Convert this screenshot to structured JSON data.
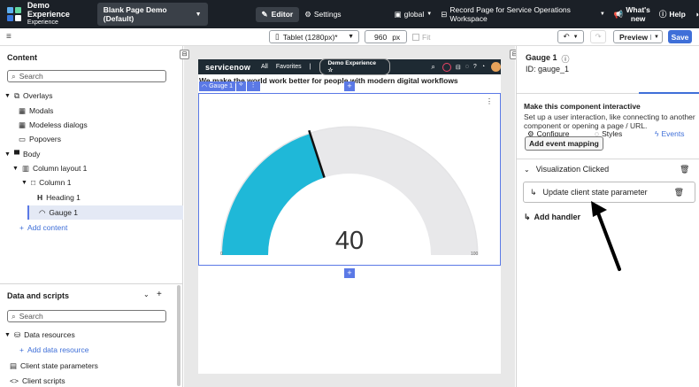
{
  "topbar": {
    "app_title": "Demo Experience",
    "app_subtitle": "Experience",
    "page_selector": "Blank Page Demo (Default)",
    "editor_label": "Editor",
    "settings_label": "Settings",
    "scope_label": "global",
    "record_page_label": "Record Page for Service Operations Workspace",
    "whats_new_line1": "What's",
    "whats_new_line2": "new",
    "help_label": "Help"
  },
  "toolbar": {
    "device_select": "Tablet (1280px)*",
    "width_value": "960",
    "width_unit": "px",
    "fit_label": "Fit",
    "preview_label": "Preview",
    "save_label": "Save"
  },
  "content_panel": {
    "title": "Content",
    "search_placeholder": "Search",
    "tree": [
      {
        "label": "Overlays",
        "icon": "layers-icon"
      },
      {
        "label": "Modals",
        "icon": "window-icon"
      },
      {
        "label": "Modeless dialogs",
        "icon": "window-icon"
      },
      {
        "label": "Popovers",
        "icon": "popover-icon"
      },
      {
        "label": "Body",
        "icon": "body-icon"
      },
      {
        "label": "Column layout 1",
        "icon": "columns-icon"
      },
      {
        "label": "Column 1",
        "icon": "column-icon"
      },
      {
        "label": "Heading 1",
        "icon": "heading-icon"
      },
      {
        "label": "Gauge 1",
        "icon": "gauge-icon"
      }
    ],
    "add_content": "Add content"
  },
  "data_panel": {
    "title": "Data and scripts",
    "search_placeholder": "Search",
    "items": [
      {
        "label": "Data resources"
      },
      {
        "label": "Add data resource"
      },
      {
        "label": "Client state parameters"
      },
      {
        "label": "Client scripts"
      }
    ]
  },
  "preview": {
    "brand": "servicenow",
    "nav_all": "All",
    "nav_favorites": "Favorites",
    "nav_badge": "Demo Experience",
    "heading_text": "We make the world work better for people with modern digital workflows",
    "selected_tag": "Gauge 1",
    "gauge": {
      "value": 40,
      "min_label": "0",
      "max_label": "100",
      "fill_color": "#1fb8d8",
      "track_color": "#e8e8ea"
    }
  },
  "right_panel": {
    "component_title": "Gauge 1",
    "component_id": "ID: gauge_1",
    "tabs": [
      {
        "label": "Configure",
        "icon": "gear-icon"
      },
      {
        "label": "Styles",
        "icon": "palette-icon"
      },
      {
        "label": "Events",
        "icon": "bolt-icon"
      }
    ],
    "interactive_title": "Make this component interactive",
    "interactive_desc": "Set up a user interaction, like connecting to another component or opening a page / URL.",
    "add_event_mapping": "Add event mapping",
    "event_name": "Visualization Clicked",
    "handler_label": "Update client state parameter",
    "add_handler": "Add handler"
  },
  "colors": {
    "accent": "#3f6fd8",
    "topbar": "#1b2027",
    "selection": "#5b79e6"
  }
}
